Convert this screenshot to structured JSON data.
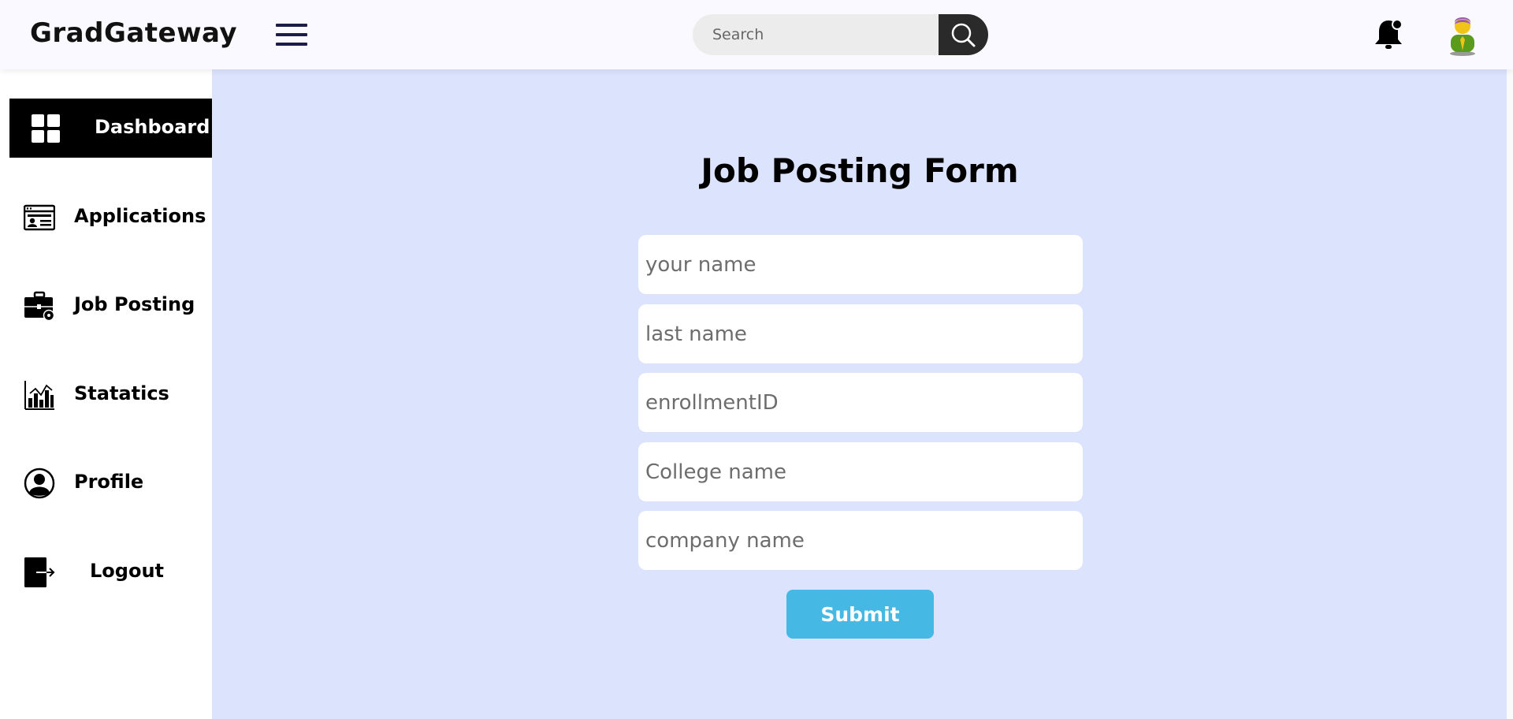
{
  "header": {
    "brand": "GradGateway",
    "search": {
      "placeholder": "Search",
      "value": ""
    }
  },
  "sidebar": {
    "items": [
      {
        "label": "Dashboard",
        "icon": "grid-icon",
        "active": true
      },
      {
        "label": "Applications",
        "icon": "id-card-icon",
        "active": false
      },
      {
        "label": "Job Posting",
        "icon": "briefcase-gear-icon",
        "active": false
      },
      {
        "label": "Statatics",
        "icon": "bar-chart-icon",
        "active": false
      },
      {
        "label": "Profile",
        "icon": "user-circle-icon",
        "active": false
      },
      {
        "label": "Logout",
        "icon": "logout-icon",
        "active": false
      }
    ]
  },
  "main": {
    "title": "Job Posting Form",
    "fields": [
      {
        "placeholder": "your name",
        "value": ""
      },
      {
        "placeholder": "last name",
        "value": ""
      },
      {
        "placeholder": "enrollmentID",
        "value": ""
      },
      {
        "placeholder": "College name",
        "value": ""
      },
      {
        "placeholder": "company name",
        "value": ""
      }
    ],
    "submit_label": "Submit"
  },
  "colors": {
    "main_background": "#dce3fc",
    "submit_button": "#45b8e3",
    "active_nav": "#000000"
  }
}
